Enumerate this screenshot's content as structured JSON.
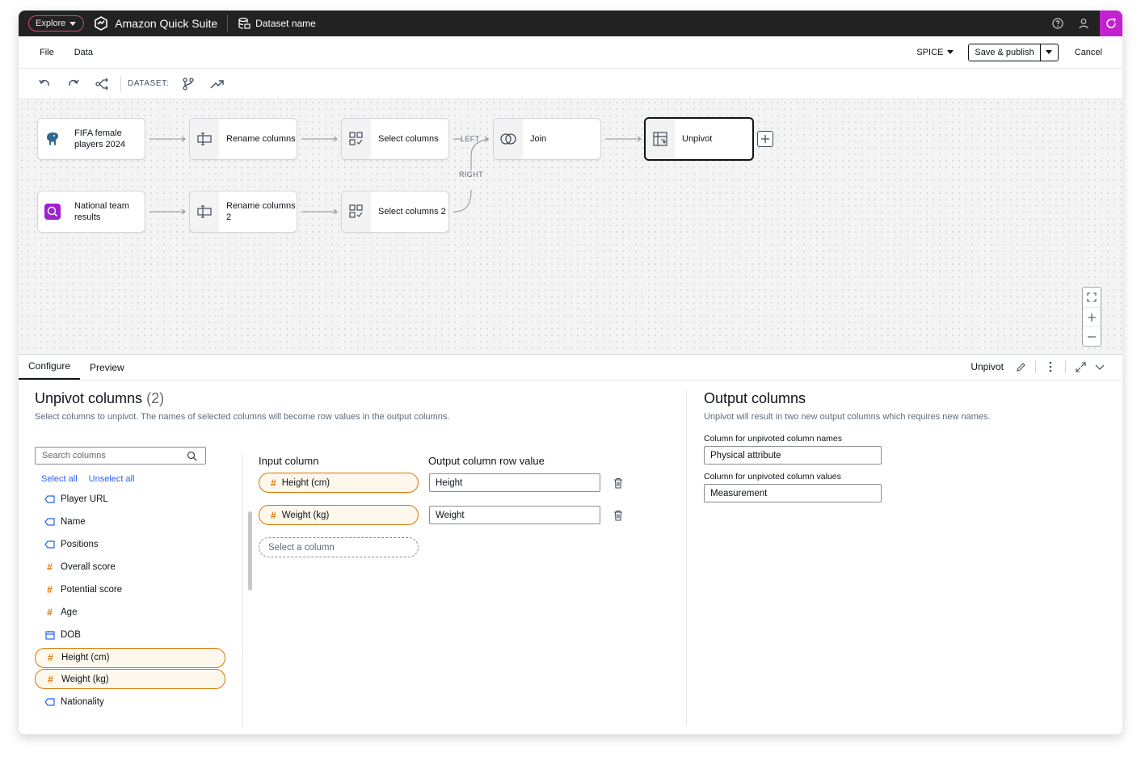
{
  "topbar": {
    "explore_label": "Explore",
    "app_name": "Amazon Quick Suite",
    "dataset_name": "Dataset name"
  },
  "menubar": {
    "file": "File",
    "data": "Data",
    "spice": "SPICE",
    "save_publish": "Save & publish",
    "cancel": "Cancel"
  },
  "toolbar": {
    "dataset_label": "DATASET:"
  },
  "canvas": {
    "nodes": [
      {
        "id": "fifa",
        "label": "FIFA female players 2024",
        "icon": "postgres-elephant-icon"
      },
      {
        "id": "rename1",
        "label": "Rename columns",
        "icon": "rename-icon"
      },
      {
        "id": "select1",
        "label": "Select columns",
        "icon": "select-columns-icon"
      },
      {
        "id": "join",
        "label": "Join",
        "icon": "join-icon"
      },
      {
        "id": "unpivot",
        "label": "Unpivot",
        "icon": "unpivot-icon"
      },
      {
        "id": "national",
        "label": "National team results",
        "icon": "data-source-icon"
      },
      {
        "id": "rename2",
        "label": "Rename columns 2",
        "icon": "rename-icon"
      },
      {
        "id": "select2",
        "label": "Select columns 2",
        "icon": "select-columns-icon"
      }
    ],
    "edge_left_label": "LEFT",
    "edge_right_label": "RIGHT"
  },
  "tabs": {
    "configure": "Configure",
    "preview": "Preview",
    "current_step": "Unpivot"
  },
  "unpivot": {
    "title": "Unpivot columns",
    "count": "(2)",
    "description": "Select columns to unpivot. The names of selected columns will become row values in the output columns.",
    "search_placeholder": "Search columns",
    "select_all": "Select all",
    "unselect_all": "Unselect all",
    "columns": [
      {
        "name": "Player URL",
        "type": "string",
        "selected": false
      },
      {
        "name": "Name",
        "type": "string",
        "selected": false
      },
      {
        "name": "Positions",
        "type": "string",
        "selected": false
      },
      {
        "name": "Overall score",
        "type": "number",
        "selected": false
      },
      {
        "name": "Potential score",
        "type": "number",
        "selected": false
      },
      {
        "name": "Age",
        "type": "number",
        "selected": false
      },
      {
        "name": "DOB",
        "type": "date",
        "selected": false
      },
      {
        "name": "Height (cm)",
        "type": "number",
        "selected": true
      },
      {
        "name": "Weight (kg)",
        "type": "number",
        "selected": true
      },
      {
        "name": "Nationality",
        "type": "string",
        "selected": false
      }
    ],
    "input_column_header": "Input column",
    "output_row_value_header": "Output column row value",
    "rows": [
      {
        "input": "Height (cm)",
        "output": "Height"
      },
      {
        "input": "Weight (kg)",
        "output": "Weight"
      }
    ],
    "select_a_column": "Select a column"
  },
  "output": {
    "title": "Output columns",
    "description": "Unpivot will result in two new output columns which requires new names.",
    "names_label": "Column for unpivoted column names",
    "names_value": "Physical attribute",
    "values_label": "Column for unpivoted column values",
    "values_value": "Measurement"
  },
  "colors": {
    "accent_pink": "#c320d0",
    "selected_orange": "#d97706",
    "link_blue": "#295eff",
    "dark_bar": "#222222"
  }
}
